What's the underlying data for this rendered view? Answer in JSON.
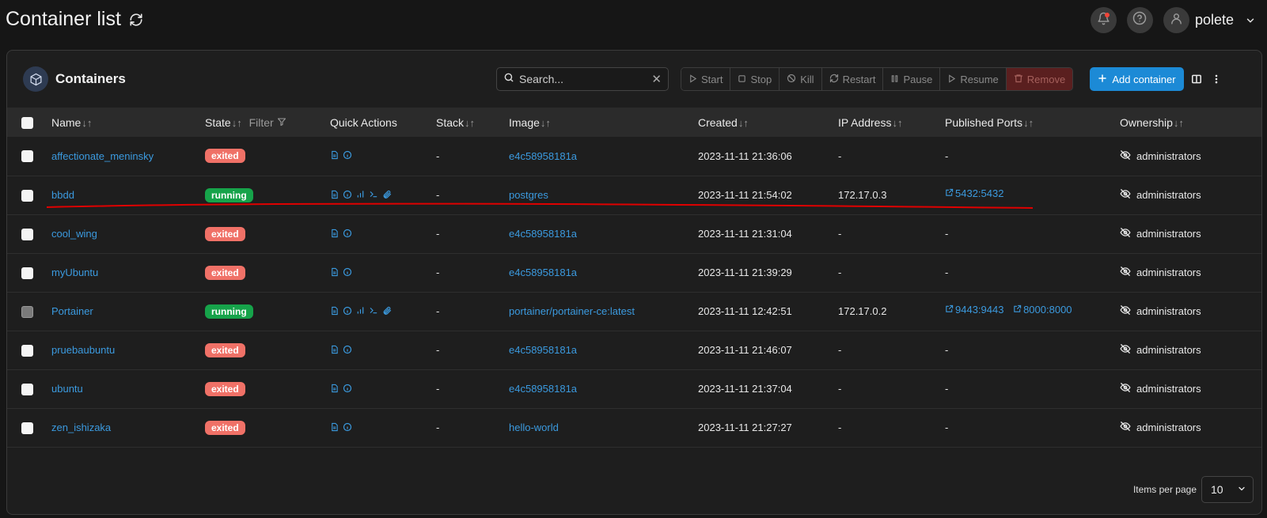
{
  "page": {
    "title": "Container list"
  },
  "user": {
    "name": "polete"
  },
  "panel": {
    "title": "Containers"
  },
  "search": {
    "placeholder": "Search...",
    "value": ""
  },
  "toolbar": {
    "start": "Start",
    "stop": "Stop",
    "kill": "Kill",
    "restart": "Restart",
    "pause": "Pause",
    "resume": "Resume",
    "remove": "Remove",
    "add": "Add container"
  },
  "table": {
    "headers": {
      "name": "Name",
      "state": "State",
      "filter": "Filter",
      "quick_actions": "Quick Actions",
      "stack": "Stack",
      "image": "Image",
      "created": "Created",
      "ip": "IP Address",
      "ports": "Published Ports",
      "ownership": "Ownership"
    },
    "rows": [
      {
        "name": "affectionate_meninsky",
        "state": "exited",
        "stack": "-",
        "image": "e4c58958181a",
        "created": "2023-11-11 21:36:06",
        "ip": "-",
        "ports": [],
        "ports_text": "-",
        "ownership": "administrators"
      },
      {
        "name": "bbdd",
        "state": "running",
        "stack": "-",
        "image": "postgres",
        "created": "2023-11-11 21:54:02",
        "ip": "172.17.0.3",
        "ports": [
          "5432:5432"
        ],
        "ports_text": "",
        "ownership": "administrators"
      },
      {
        "name": "cool_wing",
        "state": "exited",
        "stack": "-",
        "image": "e4c58958181a",
        "created": "2023-11-11 21:31:04",
        "ip": "-",
        "ports": [],
        "ports_text": "-",
        "ownership": "administrators"
      },
      {
        "name": "myUbuntu",
        "state": "exited",
        "stack": "-",
        "image": "e4c58958181a",
        "created": "2023-11-11 21:39:29",
        "ip": "-",
        "ports": [],
        "ports_text": "-",
        "ownership": "administrators"
      },
      {
        "name": "Portainer",
        "state": "running",
        "stack": "-",
        "image": "portainer/portainer-ce:latest",
        "created": "2023-11-11 12:42:51",
        "ip": "172.17.0.2",
        "ports": [
          "9443:9443",
          "8000:8000"
        ],
        "ports_text": "",
        "ownership": "administrators"
      },
      {
        "name": "pruebaubuntu",
        "state": "exited",
        "stack": "-",
        "image": "e4c58958181a",
        "created": "2023-11-11 21:46:07",
        "ip": "-",
        "ports": [],
        "ports_text": "-",
        "ownership": "administrators"
      },
      {
        "name": "ubuntu",
        "state": "exited",
        "stack": "-",
        "image": "e4c58958181a",
        "created": "2023-11-11 21:37:04",
        "ip": "-",
        "ports": [],
        "ports_text": "-",
        "ownership": "administrators"
      },
      {
        "name": "zen_ishizaka",
        "state": "exited",
        "stack": "-",
        "image": "hello-world",
        "created": "2023-11-11 21:27:27",
        "ip": "-",
        "ports": [],
        "ports_text": "-",
        "ownership": "administrators"
      }
    ]
  },
  "footer": {
    "items_per_page_label": "Items per page",
    "items_per_page": "10"
  },
  "colors": {
    "accent": "#1c8ad6",
    "link": "#3b9adf",
    "running": "#16a34a",
    "exited": "#f07167",
    "annotation": "#e00000"
  },
  "icons": [
    "refresh-icon",
    "bell-icon",
    "help-icon",
    "user-icon",
    "chevron-down-icon",
    "cube-icon",
    "search-icon",
    "close-icon",
    "play-icon",
    "stop-icon",
    "ban-icon",
    "restart-icon",
    "pause-icon",
    "trash-icon",
    "plus-icon",
    "columns-icon",
    "more-vertical-icon",
    "file-icon",
    "info-icon",
    "stats-icon",
    "console-icon",
    "attach-icon",
    "external-link-icon",
    "eye-off-icon",
    "filter-icon"
  ]
}
